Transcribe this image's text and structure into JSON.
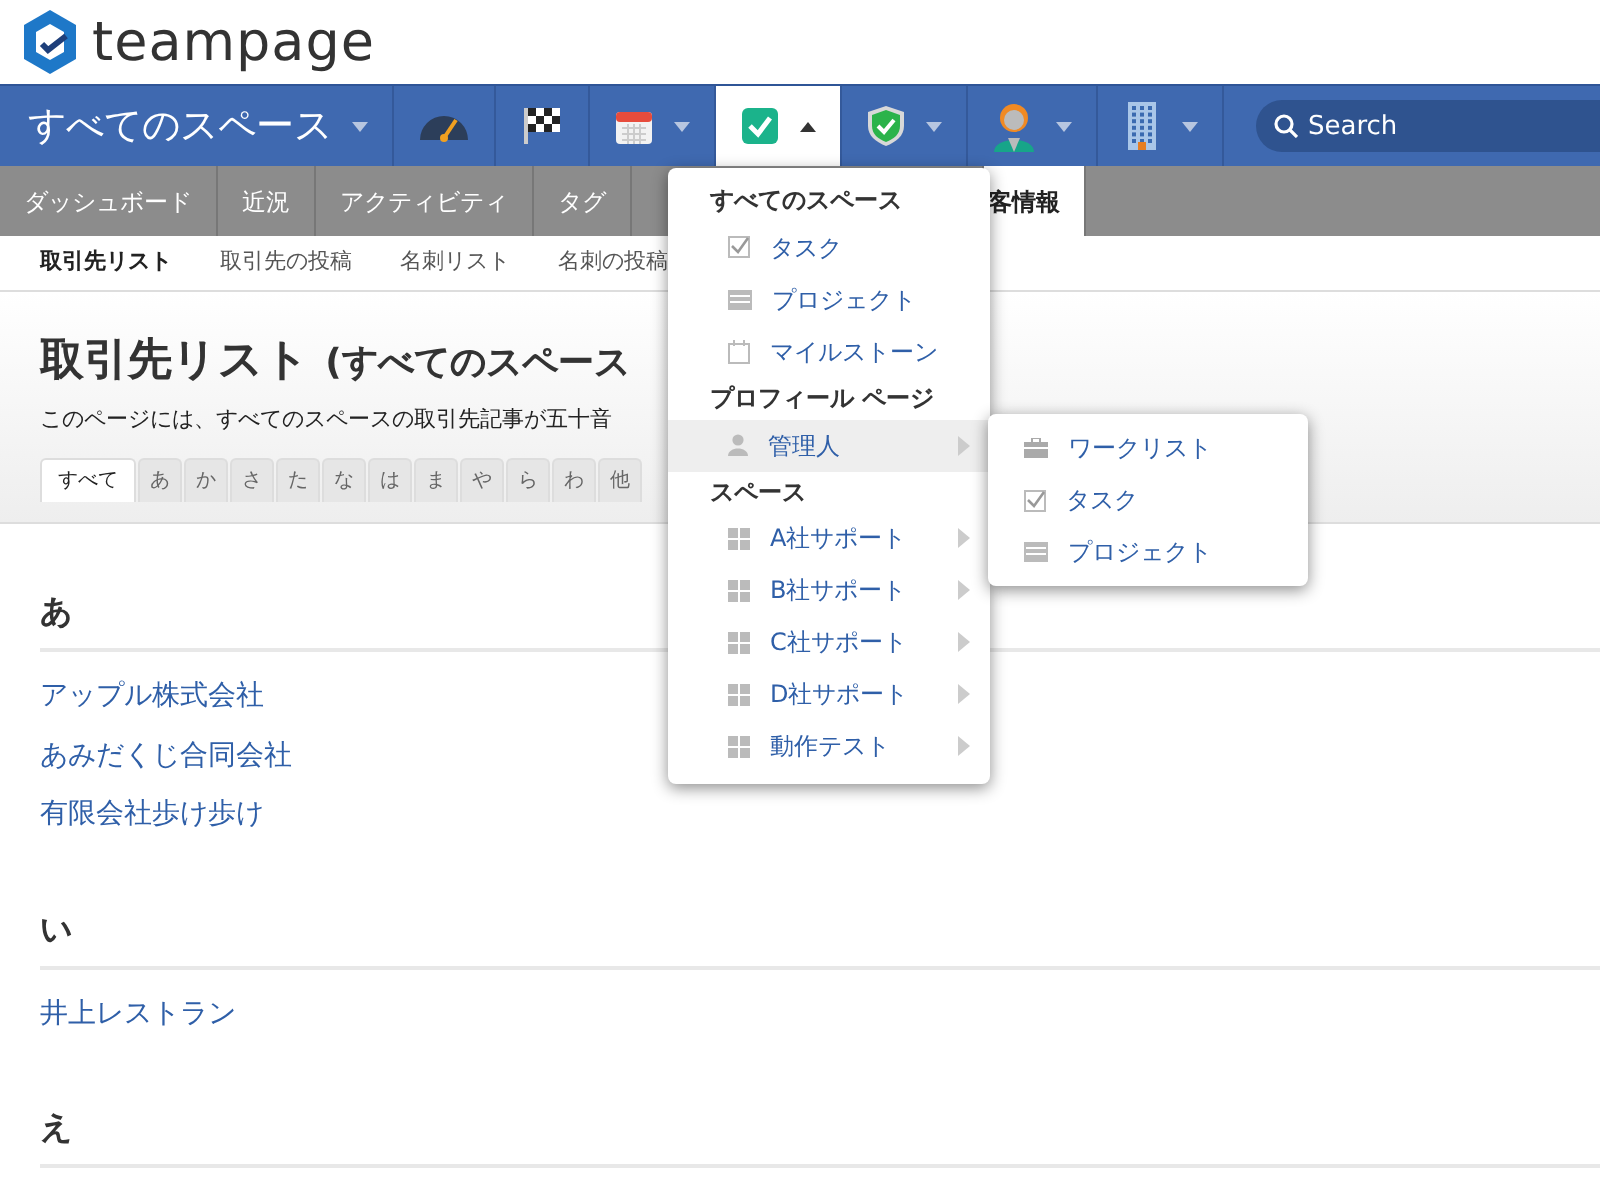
{
  "brand": {
    "name": "teampage"
  },
  "navbar": [
    {
      "kind": "space",
      "label": "すべてのスペース",
      "caret": true
    },
    {
      "kind": "gauge",
      "caret": false,
      "expanded": false
    },
    {
      "kind": "flag",
      "caret": false,
      "expanded": false
    },
    {
      "kind": "calendar",
      "caret": true,
      "expanded": false
    },
    {
      "kind": "task",
      "caret": true,
      "expanded": true
    },
    {
      "kind": "shield",
      "caret": true,
      "expanded": false
    },
    {
      "kind": "person",
      "caret": true,
      "expanded": false
    },
    {
      "kind": "building",
      "caret": true,
      "expanded": false
    },
    {
      "kind": "search",
      "placeholder": "Search"
    }
  ],
  "tabs": [
    {
      "label": "ダッシュボード",
      "selected": false
    },
    {
      "label": "近況",
      "selected": false
    },
    {
      "label": "アクティビティ",
      "selected": false
    },
    {
      "label": "タグ",
      "selected": false
    },
    {
      "label": "客情報",
      "selected": true
    }
  ],
  "subtabs": [
    {
      "label": "取引先リスト",
      "selected": true
    },
    {
      "label": "取引先の投稿",
      "selected": false
    },
    {
      "label": "名刺リスト",
      "selected": false
    },
    {
      "label": "名刺の投稿",
      "selected": false
    }
  ],
  "page": {
    "title": "取引先リスト",
    "title_suffix": "(すべてのスペース",
    "description": "このページには、すべてのスペースの取引先記事が五十音"
  },
  "letter_tabs": [
    {
      "label": "すべて",
      "selected": true
    },
    {
      "label": "あ",
      "selected": false
    },
    {
      "label": "か",
      "selected": false
    },
    {
      "label": "さ",
      "selected": false
    },
    {
      "label": "た",
      "selected": false
    },
    {
      "label": "な",
      "selected": false
    },
    {
      "label": "は",
      "selected": false
    },
    {
      "label": "ま",
      "selected": false
    },
    {
      "label": "や",
      "selected": false
    },
    {
      "label": "ら",
      "selected": false
    },
    {
      "label": "わ",
      "selected": false
    },
    {
      "label": "他",
      "selected": false
    }
  ],
  "groups": [
    {
      "heading": "あ",
      "entries": [
        "アップル株式会社",
        "あみだくじ合同会社",
        "有限会社歩け歩け"
      ]
    },
    {
      "heading": "い",
      "entries": [
        "井上レストラン"
      ]
    },
    {
      "heading": "え"
    }
  ],
  "menu": {
    "sections": [
      {
        "header": "すべてのスペース",
        "items": [
          {
            "kind": "check",
            "label": "タスク",
            "submenu": false,
            "highlighted": false
          },
          {
            "kind": "project",
            "label": "プロジェクト",
            "submenu": false,
            "highlighted": false
          },
          {
            "kind": "calendar",
            "label": "マイルストーン",
            "submenu": false,
            "highlighted": false
          }
        ]
      },
      {
        "header": "プロフィール ページ",
        "items": [
          {
            "kind": "person",
            "label": "管理人",
            "submenu": true,
            "highlighted": true
          }
        ]
      },
      {
        "header": "スペース",
        "items": [
          {
            "kind": "grid",
            "label": "A社サポート",
            "submenu": true,
            "highlighted": false
          },
          {
            "kind": "grid",
            "label": "B社サポート",
            "submenu": true,
            "highlighted": false
          },
          {
            "kind": "grid",
            "label": "C社サポート",
            "submenu": true,
            "highlighted": false
          },
          {
            "kind": "grid",
            "label": "D社サポート",
            "submenu": true,
            "highlighted": false
          },
          {
            "kind": "grid",
            "label": "動作テスト",
            "submenu": true,
            "highlighted": false
          }
        ]
      }
    ],
    "submenu": [
      {
        "kind": "briefcase",
        "label": "ワークリスト"
      },
      {
        "kind": "check",
        "label": "タスク"
      },
      {
        "kind": "project",
        "label": "プロジェクト"
      }
    ]
  }
}
